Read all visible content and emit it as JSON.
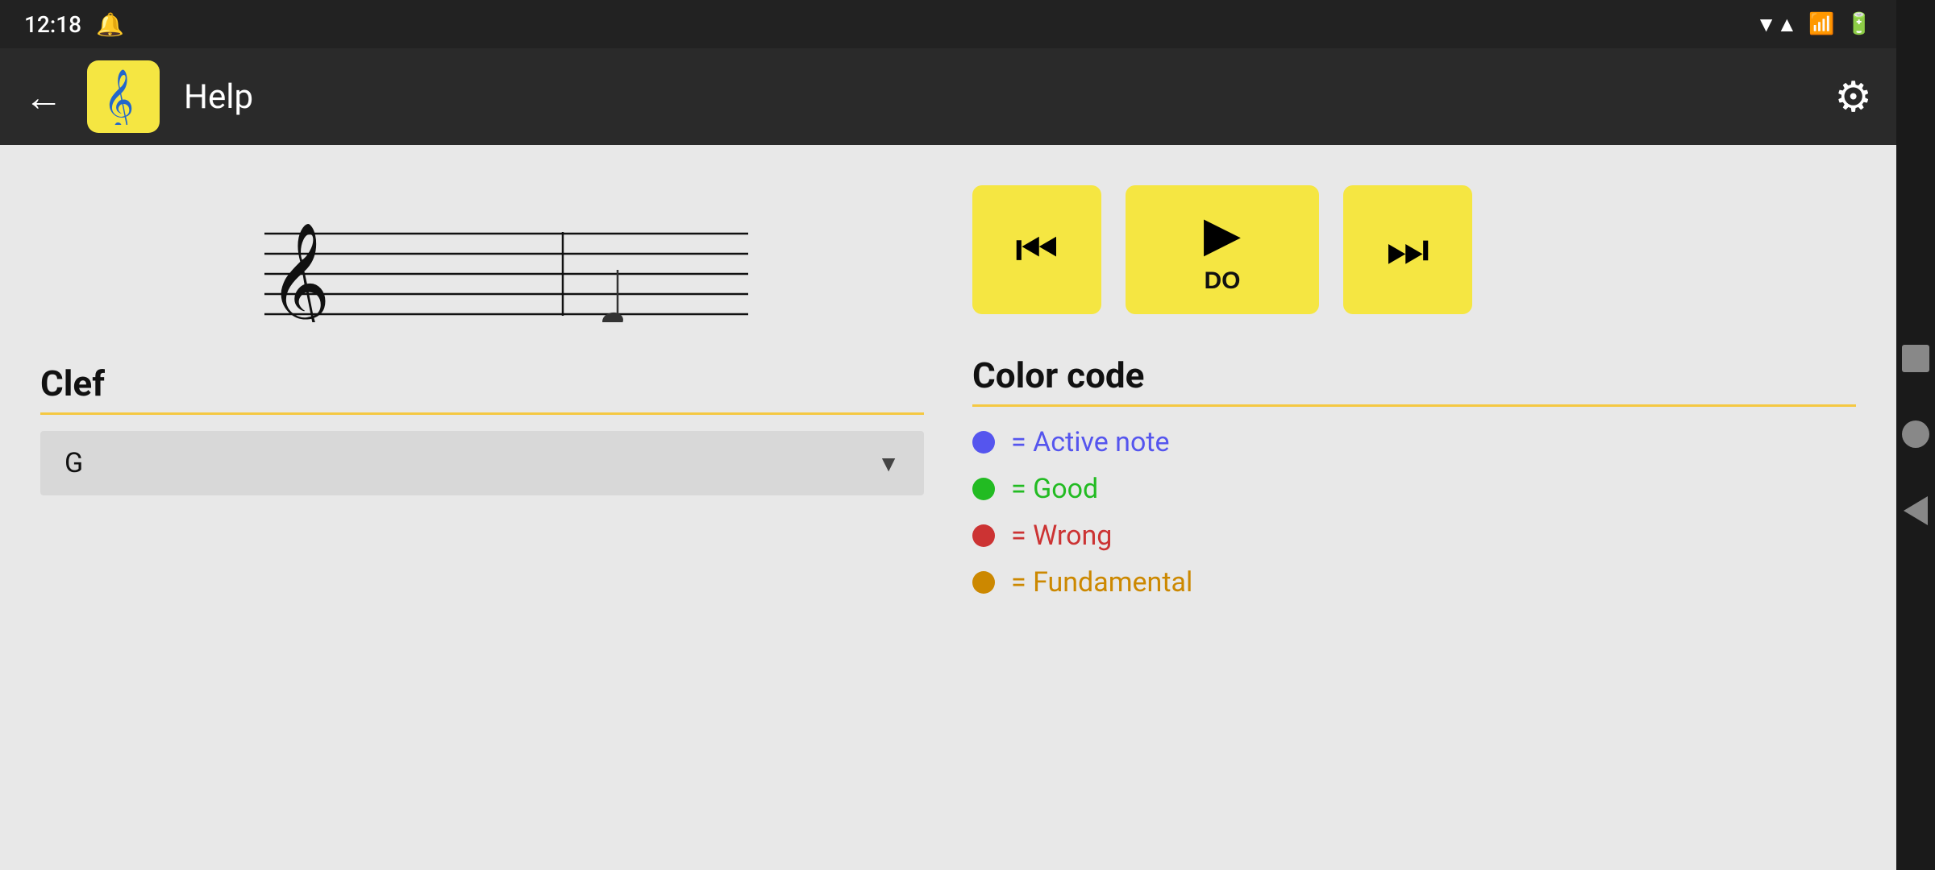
{
  "statusBar": {
    "time": "12:18",
    "wifiIcon": "wifi",
    "signalIcon": "signal",
    "batteryIcon": "battery"
  },
  "appBar": {
    "backLabel": "←",
    "appIconSymbol": "𝄞",
    "title": "Help",
    "settingsIcon": "⚙"
  },
  "leftPanel": {
    "clefSection": {
      "title": "Clef",
      "dropdownValue": "G",
      "dropdownArrow": "▼"
    }
  },
  "rightPanel": {
    "transportButtons": {
      "prevIcon": "⏮",
      "playIcon": "▶",
      "playLabel": "DO",
      "nextIcon": "⏭"
    },
    "colorCode": {
      "title": "Color code",
      "items": [
        {
          "color": "#5555ee",
          "text": "= Active note",
          "class": "active"
        },
        {
          "color": "#22bb22",
          "text": "= Good",
          "class": "good"
        },
        {
          "color": "#cc3333",
          "text": "= Wrong",
          "class": "wrong"
        },
        {
          "color": "#cc8800",
          "text": "= Fundamental",
          "class": "fundamental"
        }
      ]
    }
  },
  "androidNav": {
    "squareLabel": "square",
    "circleLabel": "circle",
    "backLabel": "back"
  }
}
